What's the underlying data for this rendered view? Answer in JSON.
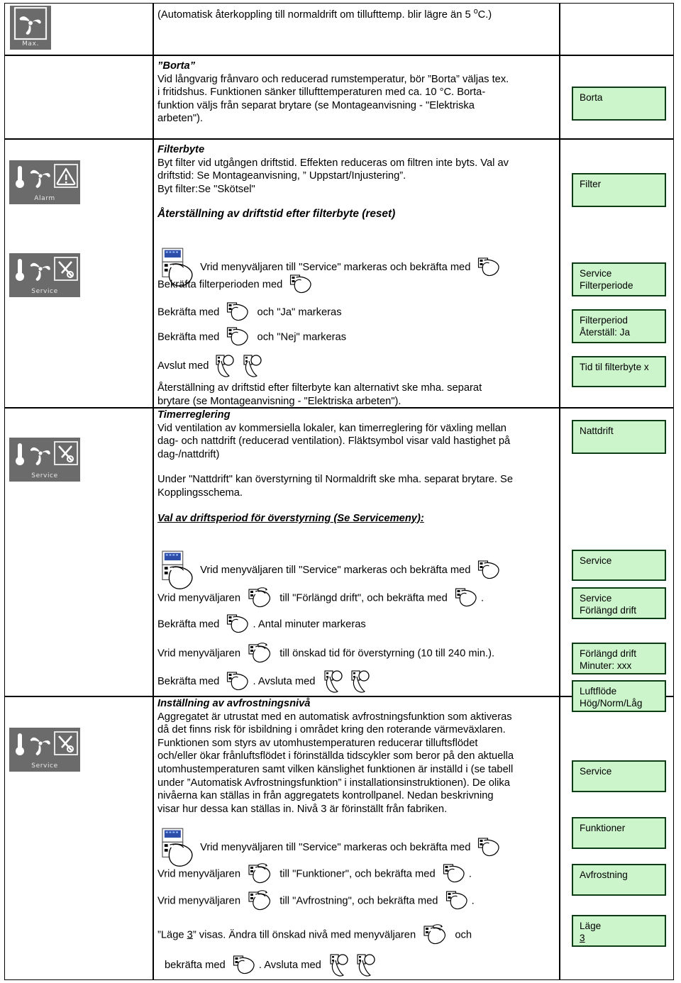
{
  "colors": {
    "green_fill": "#ccf5cc",
    "green_border": "#0d3d14",
    "lcd_bg": "#6b6b6b",
    "rule": "#000000"
  },
  "left_panels": [
    {
      "name": "max-fan-panel",
      "label": "Max."
    },
    {
      "name": "alarm-panel",
      "label": "Alarm"
    },
    {
      "name": "service-panel-1",
      "label": "Service"
    },
    {
      "name": "service-panel-2",
      "label": "Service"
    },
    {
      "name": "service-panel-3",
      "label": "Service"
    }
  ],
  "rows": {
    "auto_return": {
      "text": "(Automatisk återkoppling till normaldrift om tillufttemp. blir lägre än 5 °C.)"
    },
    "borta": {
      "heading": "”Borta”",
      "lines": [
        "Vid långvarig frånvaro och reducerad rumstemperatur, bör ”Borta” väljas tex.",
        "i fritidshus. Funktionen sänker tillufttemperaturen med ca. 10 °C. Borta-",
        "funktion väljs från separat brytare (se Montageanvisning - \"Elektriska",
        "arbeten\")."
      ]
    },
    "filterbyte": {
      "heading": "Filterbyte",
      "lines": [
        "Byt filter vid utgången driftstid. Effekten reduceras om filtren inte byts. Val av",
        "driftstid: Se Montageanvisning, ” Uppstart/Injustering”.",
        "Byt filter:Se \"Skötsel\""
      ],
      "subheading": "Återställning av driftstid efter filterbyte (reset)",
      "steps": [
        {
          "pre": "",
          "mid": "Vrid menyväljaren till \"Service\" markeras och bekräfta med",
          "post": ""
        },
        {
          "pre": "Bekräfta filterperioden med",
          "mid": "",
          "post": ""
        },
        {
          "pre": "Bekräfta med",
          "mid": "",
          "post": "och \"Ja\" markeras"
        },
        {
          "pre": "Bekräfta med",
          "mid": "",
          "post": "och \"Nej\" markeras"
        },
        {
          "pre": "Avslut med",
          "mid": "",
          "post": ""
        }
      ],
      "footer": [
        "Återställning av driftstid efter filterbyte kan alternativt ske mha. separat",
        "brytare (se Montageanvisning - \"Elektriska arbeten\")."
      ]
    },
    "timerreglering": {
      "heading": "Timerreglering",
      "lines": [
        "Vid ventilation av kommersiella lokaler, kan timerreglering för växling mellan",
        "dag- och nattdrift (reducerad ventilation). Fläktsymbol visar vald hastighet på",
        "dag-/nattdrift)"
      ],
      "lines2": [
        "Under \"Nattdrift\" kan överstyrning til Normaldrift ske mha. separat brytare. Se",
        "Kopplingsschema."
      ],
      "subheading": "Val av driftsperiod för överstyrning (Se Servicemeny):",
      "steps": [
        {
          "a": "",
          "b": "Vrid menyväljaren till \"Service\" markeras och bekräfta med",
          "c": ""
        },
        {
          "a": "Vrid menyväljaren",
          "b": "till \"Förlängd drift\", och bekräfta med",
          "c": "."
        },
        {
          "a": "Bekräfta med",
          "b": ". Antal minuter markeras",
          "c": ""
        },
        {
          "a": "Vrid menyväljaren",
          "b": "till önskad tid för överstyrning (10 till 240 min.).",
          "c": ""
        },
        {
          "a": "Bekräfta med",
          "b": ". Avsluta med",
          "c": ""
        }
      ]
    },
    "avfrostning": {
      "heading": "Inställning av avfrostningsnivå",
      "lines": [
        "Aggregatet är utrustat med en automatisk avfrostningsfunktion som aktiveras",
        "då det finns risk för isbildning i området kring den roterande värmeväxlaren.",
        "Funktionen som styrs av utomhustemperaturen reducerar tilluftsflödet",
        "och/eller ökar frånluftsflödet i förinställda tidscykler som beror på den aktuella",
        "utomhustemperaturen samt vilken känslighet funktionen är inställd i (se tabell",
        "under ”Automatisk Avfrostningsfunktion” i installationsinstruktionen). De olika",
        "nivåerna kan ställas in från aggregatets kontrollpanel. Nedan beskrivning",
        "visar hur dessa kan ställas in. Nivå 3 är förinställt från fabriken."
      ],
      "steps": [
        {
          "a": "",
          "b": "Vrid menyväljaren till \"Service\" markeras och bekräfta med",
          "c": ""
        },
        {
          "a": "Vrid menyväljaren",
          "b": "till \"Funktioner\", och bekräfta med",
          "c": "."
        },
        {
          "a": "Vrid menyväljaren",
          "b": "till \"Avfrostning\", och bekräfta med",
          "c": "."
        },
        {
          "a": "”Läge ",
          "u": "3",
          "b": "” visas. Ändra till önskad nivå med menyväljaren",
          "c": "och"
        },
        {
          "a": "bekräfta med",
          "b": ". Avsluta med",
          "c": ""
        }
      ]
    }
  },
  "green_boxes": [
    {
      "name": "display-borta",
      "lines": [
        "Borta"
      ]
    },
    {
      "name": "display-filter",
      "lines": [
        "Filter"
      ]
    },
    {
      "name": "display-service-filterperiode",
      "lines": [
        "Service",
        "Filterperiode"
      ]
    },
    {
      "name": "display-filterperiod-reset",
      "lines": [
        "Filterperiod",
        "Återställ: Ja"
      ]
    },
    {
      "name": "display-tid-til-filterbyte",
      "lines": [
        "Tid til filterbyte x"
      ]
    },
    {
      "name": "display-nattdrift",
      "lines": [
        "Nattdrift"
      ]
    },
    {
      "name": "display-service-1",
      "lines": [
        "Service"
      ]
    },
    {
      "name": "display-service-forlangd",
      "lines": [
        "Service",
        "Förlängd drift"
      ]
    },
    {
      "name": "display-forlangd-minuter",
      "lines": [
        "Förlängd drift",
        "Minuter:  xxx"
      ]
    },
    {
      "name": "display-luftflode",
      "lines": [
        "Luftflöde",
        "Hög/Norm/Låg"
      ]
    },
    {
      "name": "display-service-2",
      "lines": [
        "Service"
      ]
    },
    {
      "name": "display-funktioner",
      "lines": [
        "Funktioner"
      ]
    },
    {
      "name": "display-avfrostning",
      "lines": [
        "Avfrostning"
      ]
    },
    {
      "name": "display-lage-3",
      "lines": [
        "Läge 3"
      ]
    }
  ]
}
